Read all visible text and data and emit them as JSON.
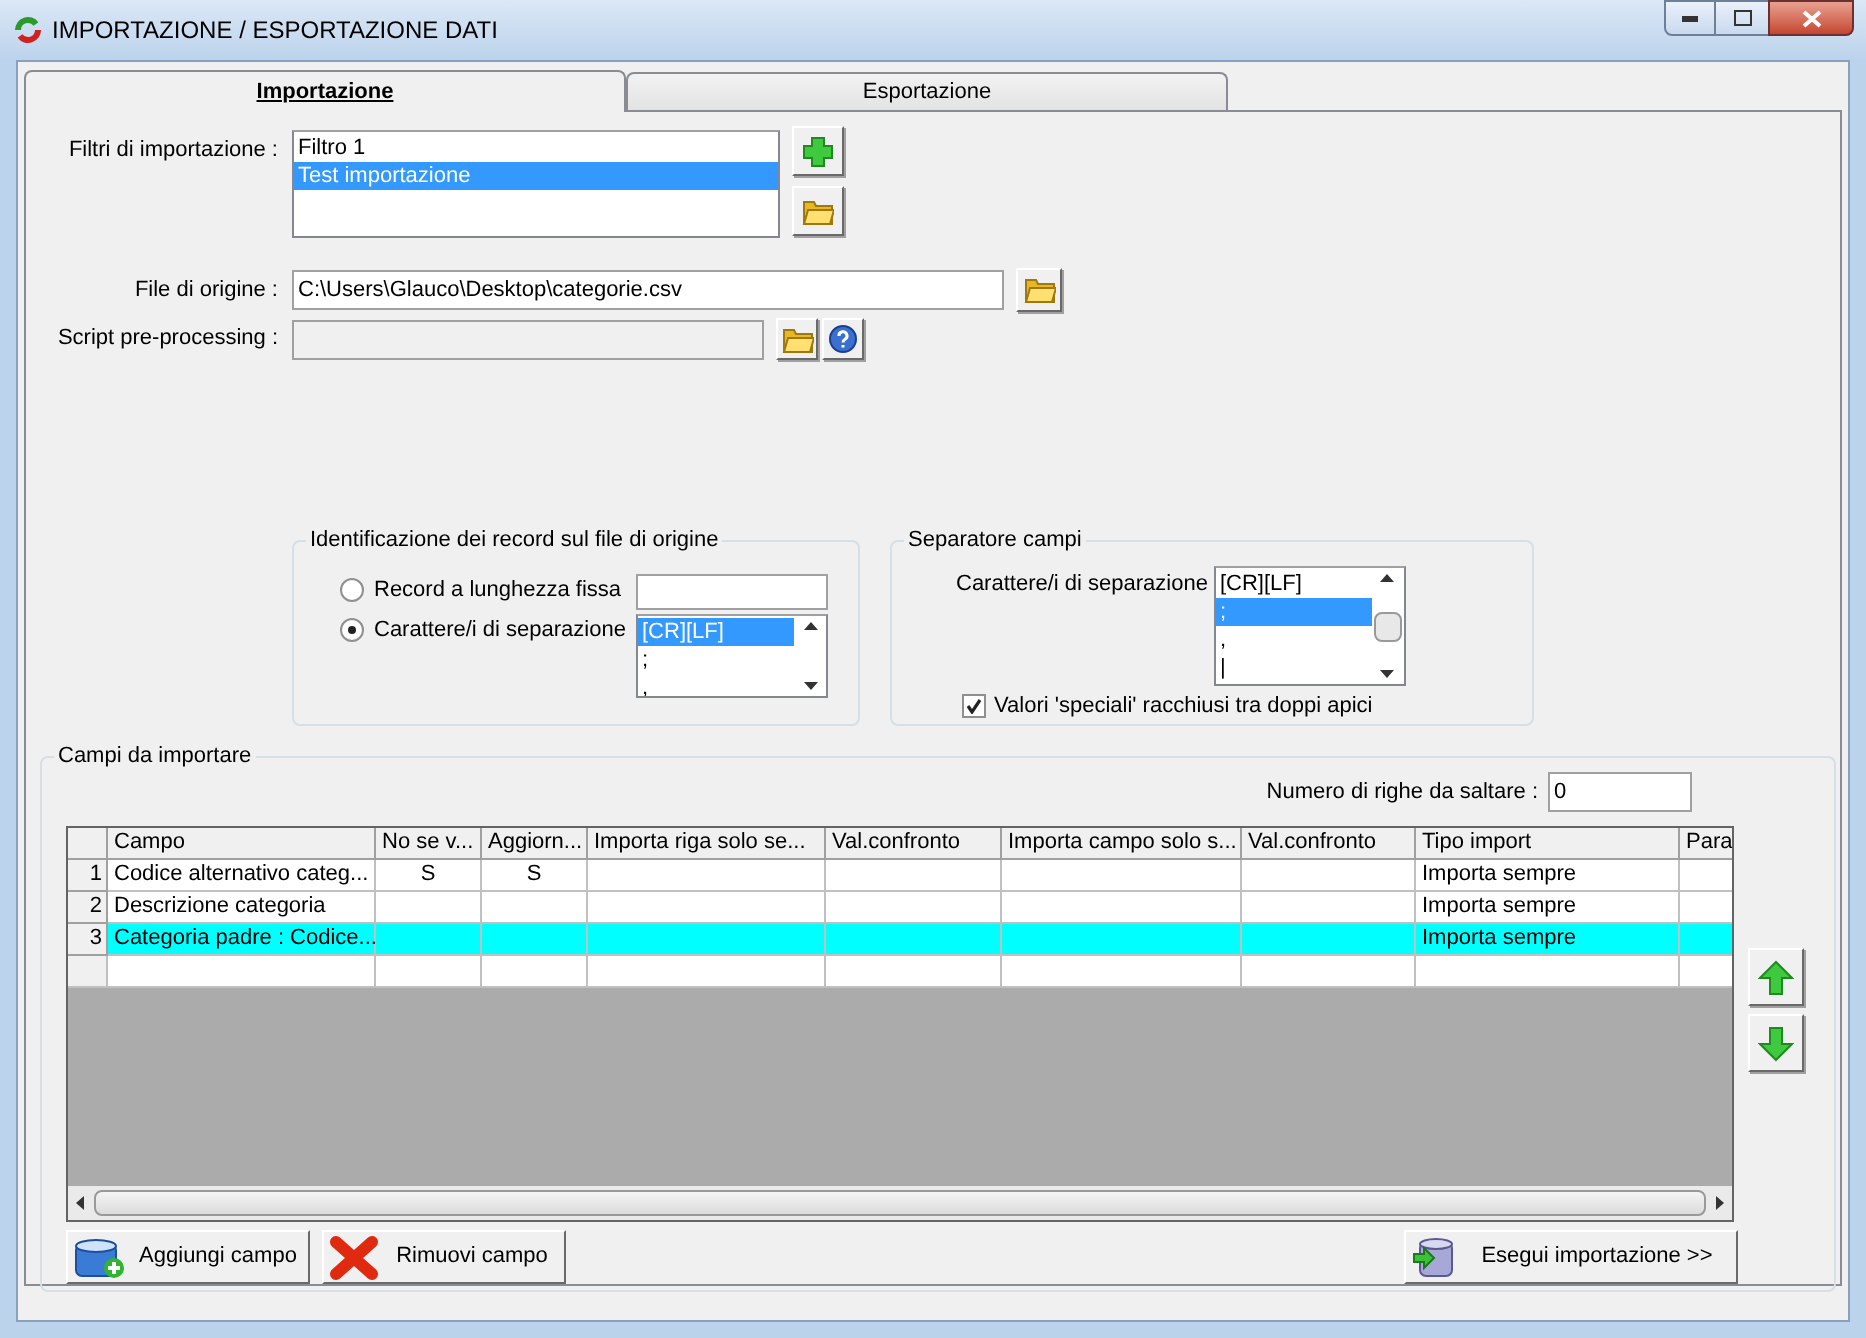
{
  "window": {
    "title": "IMPORTAZIONE / ESPORTAZIONE DATI"
  },
  "tabs": [
    {
      "label": "Importazione",
      "selected": true
    },
    {
      "label": "Esportazione",
      "selected": false
    }
  ],
  "filters": {
    "label": "Filtri di importazione :",
    "items": [
      {
        "text": "Filtro 1",
        "selected": false
      },
      {
        "text": "Test importazione",
        "selected": true
      }
    ]
  },
  "source_file": {
    "label": "File di origine :",
    "value": "C:\\Users\\Glauco\\Desktop\\categorie.csv"
  },
  "script": {
    "label": "Script pre-processing :",
    "disabled": true
  },
  "record_identification": {
    "title": "Identificazione dei record sul file di origine",
    "options": [
      {
        "label": "Record a lunghezza fissa",
        "selected": false,
        "kind": "input"
      },
      {
        "label": "Carattere/i di separazione",
        "selected": true,
        "kind": "list",
        "items": [
          {
            "text": "[CR][LF]",
            "selected": true
          },
          {
            "text": ";",
            "selected": false
          },
          {
            "text": ",",
            "selected": false
          }
        ]
      }
    ]
  },
  "field_separator": {
    "title": "Separatore campi",
    "label": "Carattere/i di separazione",
    "items": [
      {
        "text": "[CR][LF]",
        "selected": false
      },
      {
        "text": ";",
        "selected": true
      },
      {
        "text": ",",
        "selected": false
      },
      {
        "text": "|",
        "selected": false
      }
    ],
    "checkbox": {
      "label": "Valori 'speciali' racchiusi tra doppi apici",
      "checked": true
    }
  },
  "import_fields": {
    "title": "Campi da importare",
    "skip_rows": {
      "label": "Numero di righe da saltare  :",
      "value": "0"
    },
    "table": {
      "columns": [
        "Campo",
        "No se v...",
        "Aggiorn...",
        "Importa riga solo se...",
        "Val.confronto",
        "Importa campo solo s...",
        "Val.confronto",
        "Tipo import",
        "Para"
      ],
      "rows": [
        {
          "number": "1",
          "selected": false,
          "cells": [
            "Codice alternativo categ...",
            "S",
            "S",
            null,
            null,
            null,
            null,
            "Importa sempre",
            null
          ]
        },
        {
          "number": "2",
          "selected": false,
          "cells": [
            "Descrizione categoria",
            null,
            null,
            null,
            null,
            null,
            null,
            "Importa sempre",
            null
          ]
        },
        {
          "number": "3",
          "selected": true,
          "cells": [
            "Categoria padre : Codice...",
            null,
            null,
            null,
            null,
            null,
            null,
            "Importa sempre",
            null
          ]
        }
      ]
    }
  },
  "buttons": [
    {
      "label": "Aggiungi campo",
      "kind": "add"
    },
    {
      "label": "Rimuovi campo",
      "kind": "remove"
    },
    {
      "label": "Esegui importazione >>",
      "kind": "run"
    }
  ]
}
